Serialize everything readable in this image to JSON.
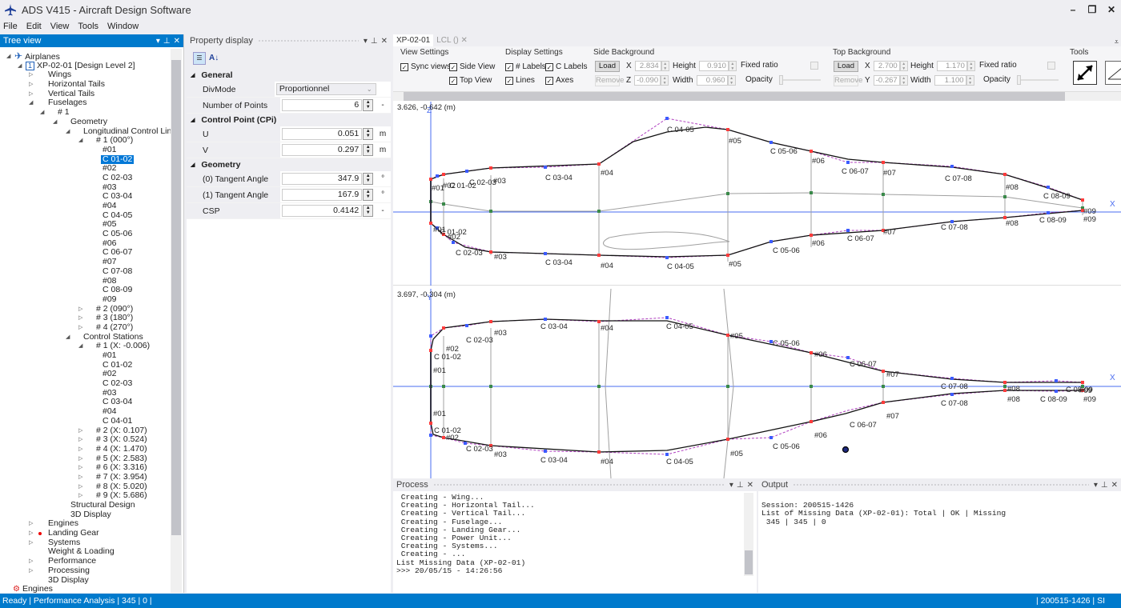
{
  "window": {
    "title": "ADS V415 - Aircraft Design Software",
    "controls": {
      "minimize": "–",
      "restore": "❐",
      "close": "✕"
    }
  },
  "menu": [
    "File",
    "Edit",
    "View",
    "Tools",
    "Window"
  ],
  "tree_panel": {
    "title": "Tree view",
    "nodes": [
      {
        "label": "Airplanes",
        "depth": 0,
        "arrow": "expanded",
        "icon": "airplane-icon"
      },
      {
        "label": "XP-02-01 [Design Level 2]",
        "depth": 1,
        "arrow": "expanded",
        "badge": "1"
      },
      {
        "label": "Wings",
        "depth": 2,
        "arrow": "collapsed"
      },
      {
        "label": "Horizontal Tails",
        "depth": 2,
        "arrow": "collapsed"
      },
      {
        "label": "Vertical Tails",
        "depth": 2,
        "arrow": "collapsed"
      },
      {
        "label": "Fuselages",
        "depth": 2,
        "arrow": "expanded"
      },
      {
        "label": "# 1",
        "depth": 3,
        "arrow": "expanded"
      },
      {
        "label": "Geometry",
        "depth": 4,
        "arrow": "expanded"
      },
      {
        "label": "Longitudinal Control Lines",
        "depth": 5,
        "arrow": "expanded"
      },
      {
        "label": "# 1 (000°)",
        "depth": 6,
        "arrow": "expanded"
      },
      {
        "label": "#01",
        "depth": 7
      },
      {
        "label": "C 01-02",
        "depth": 7,
        "selected": true
      },
      {
        "label": "#02",
        "depth": 7
      },
      {
        "label": "C 02-03",
        "depth": 7
      },
      {
        "label": "#03",
        "depth": 7
      },
      {
        "label": "C 03-04",
        "depth": 7
      },
      {
        "label": "#04",
        "depth": 7
      },
      {
        "label": "C 04-05",
        "depth": 7
      },
      {
        "label": "#05",
        "depth": 7
      },
      {
        "label": "C 05-06",
        "depth": 7
      },
      {
        "label": "#06",
        "depth": 7
      },
      {
        "label": "C 06-07",
        "depth": 7
      },
      {
        "label": "#07",
        "depth": 7
      },
      {
        "label": "C 07-08",
        "depth": 7
      },
      {
        "label": "#08",
        "depth": 7
      },
      {
        "label": "C 08-09",
        "depth": 7
      },
      {
        "label": "#09",
        "depth": 7
      },
      {
        "label": "# 2 (090°)",
        "depth": 6,
        "arrow": "collapsed"
      },
      {
        "label": "# 3 (180°)",
        "depth": 6,
        "arrow": "collapsed"
      },
      {
        "label": "# 4 (270°)",
        "depth": 6,
        "arrow": "collapsed"
      },
      {
        "label": "Control Stations",
        "depth": 5,
        "arrow": "expanded"
      },
      {
        "label": "# 1 (X: -0.006)",
        "depth": 6,
        "arrow": "expanded"
      },
      {
        "label": "#01",
        "depth": 7
      },
      {
        "label": "C 01-02",
        "depth": 7
      },
      {
        "label": "#02",
        "depth": 7
      },
      {
        "label": "C 02-03",
        "depth": 7
      },
      {
        "label": "#03",
        "depth": 7
      },
      {
        "label": "C 03-04",
        "depth": 7
      },
      {
        "label": "#04",
        "depth": 7
      },
      {
        "label": "C 04-01",
        "depth": 7
      },
      {
        "label": "# 2 (X: 0.107)",
        "depth": 6,
        "arrow": "collapsed"
      },
      {
        "label": "# 3 (X: 0.524)",
        "depth": 6,
        "arrow": "collapsed"
      },
      {
        "label": "# 4 (X: 1.470)",
        "depth": 6,
        "arrow": "collapsed"
      },
      {
        "label": "# 5 (X: 2.583)",
        "depth": 6,
        "arrow": "collapsed"
      },
      {
        "label": "# 6 (X: 3.316)",
        "depth": 6,
        "arrow": "collapsed"
      },
      {
        "label": "# 7 (X: 3.954)",
        "depth": 6,
        "arrow": "collapsed"
      },
      {
        "label": "# 8 (X: 5.020)",
        "depth": 6,
        "arrow": "collapsed"
      },
      {
        "label": "# 9 (X: 5.686)",
        "depth": 6,
        "arrow": "collapsed"
      },
      {
        "label": "Structural Design",
        "depth": 4
      },
      {
        "label": "3D Display",
        "depth": 4
      },
      {
        "label": "Engines",
        "depth": 2,
        "arrow": "collapsed"
      },
      {
        "label": "Landing Gear",
        "depth": 2,
        "arrow": "collapsed",
        "marker": "red-dot"
      },
      {
        "label": "Systems",
        "depth": 2,
        "arrow": "collapsed"
      },
      {
        "label": "Weight & Loading",
        "depth": 2
      },
      {
        "label": "Performance",
        "depth": 2,
        "arrow": "collapsed"
      },
      {
        "label": "Processing",
        "depth": 2,
        "arrow": "collapsed"
      },
      {
        "label": "3D Display",
        "depth": 2
      },
      {
        "label": "Engines",
        "depth": 0,
        "icon": "engine-icon"
      }
    ]
  },
  "property_panel": {
    "title": "Property display",
    "toolbar": {
      "categorized": "categorized-icon",
      "alphabetical": "sort-az-icon"
    },
    "categories": [
      {
        "name": "General",
        "rows": [
          {
            "name": "DivMode",
            "value": "Proportionnel",
            "type": "select",
            "unit": ""
          },
          {
            "name": "Number of Points",
            "value": "6",
            "type": "spin",
            "unit": "-"
          }
        ]
      },
      {
        "name": "Control Point (CPi)",
        "rows": [
          {
            "name": "U",
            "value": "0.051",
            "type": "spin",
            "unit": "m"
          },
          {
            "name": "V",
            "value": "0.297",
            "type": "spin",
            "unit": "m"
          }
        ]
      },
      {
        "name": "Geometry",
        "rows": [
          {
            "name": "(0) Tangent Angle",
            "value": "347.9",
            "type": "spin",
            "unit": "°"
          },
          {
            "name": "(1) Tangent Angle",
            "value": "167.9",
            "type": "spin",
            "unit": "°"
          },
          {
            "name": "CSP",
            "value": "0.4142",
            "type": "spin",
            "unit": "-"
          }
        ]
      }
    ]
  },
  "document": {
    "tabs": [
      {
        "label": "XP-02-01",
        "active": true
      },
      {
        "label": "LCL ()",
        "active": false,
        "closable": true
      }
    ],
    "view_settings": {
      "title": "View Settings",
      "sync_views": {
        "label": "Sync views",
        "checked": true
      },
      "side_view": {
        "label": "Side View",
        "checked": true
      },
      "top_view": {
        "label": "Top View",
        "checked": true
      }
    },
    "display_settings": {
      "title": "Display Settings",
      "hash_labels": {
        "label": "# Labels",
        "checked": true
      },
      "c_labels": {
        "label": "C Labels",
        "checked": true
      },
      "lines": {
        "label": "Lines",
        "checked": true
      },
      "axes": {
        "label": "Axes",
        "checked": true
      }
    },
    "side_background": {
      "title": "Side Background",
      "load": "Load",
      "remove": "Remove",
      "x_label": "X",
      "x": "2.834",
      "z_label": "Z",
      "z": "-0.090",
      "height_label": "Height",
      "height": "0.910",
      "width_label": "Width",
      "width": "0.960",
      "fixed_ratio": "Fixed ratio",
      "opacity": "Opacity"
    },
    "top_background": {
      "title": "Top Background",
      "load": "Load",
      "remove": "Remove",
      "x_label": "X",
      "x": "2.700",
      "y_label": "Y",
      "y": "-0.267",
      "height_label": "Height",
      "height": "1.170",
      "width_label": "Width",
      "width": "1.100",
      "fixed_ratio": "Fixed ratio",
      "opacity": "Opacity"
    },
    "tools": {
      "title": "Tools",
      "items": [
        "resize-arrow-icon",
        "angle-icon"
      ]
    },
    "side_view": {
      "coord": "3.626, -0.642 (m)",
      "axis_x": "X",
      "axis_z": "Z"
    },
    "top_view": {
      "coord": "3.697, -0.304 (m)",
      "axis_x": "X",
      "axis_y": "Y"
    }
  },
  "process_panel": {
    "title": "Process",
    "lines": [
      " Creating - Wing...",
      " Creating - Horizontal Tail...",
      " Creating - Vertical Tail...",
      " Creating - Fuselage...",
      " Creating - Landing Gear...",
      " Creating - Power Unit...",
      " Creating - Systems...",
      " Creating - ...",
      "List Missing Data (XP-02-01)",
      ">>> 20/05/15 - 14:26:56"
    ]
  },
  "output_panel": {
    "title": "Output",
    "lines": [
      "",
      "Session: 200515-1426",
      "List of Missing Data (XP-02-01): Total | OK | Missing",
      " 345 | 345 | 0"
    ]
  },
  "statusbar": {
    "left": "Ready |  Performance Analysis |  345 |  0 |",
    "right": "| 200515-1426 |  SI"
  },
  "colors": {
    "accent": "#007acc",
    "node_point": "#ff3b3b",
    "control_point": "#3b5bff",
    "axis": "#4a6cf0",
    "control_polygon": "#b040c0",
    "station_line": "#a0a0a0",
    "center_point": "#3a8a4a"
  }
}
